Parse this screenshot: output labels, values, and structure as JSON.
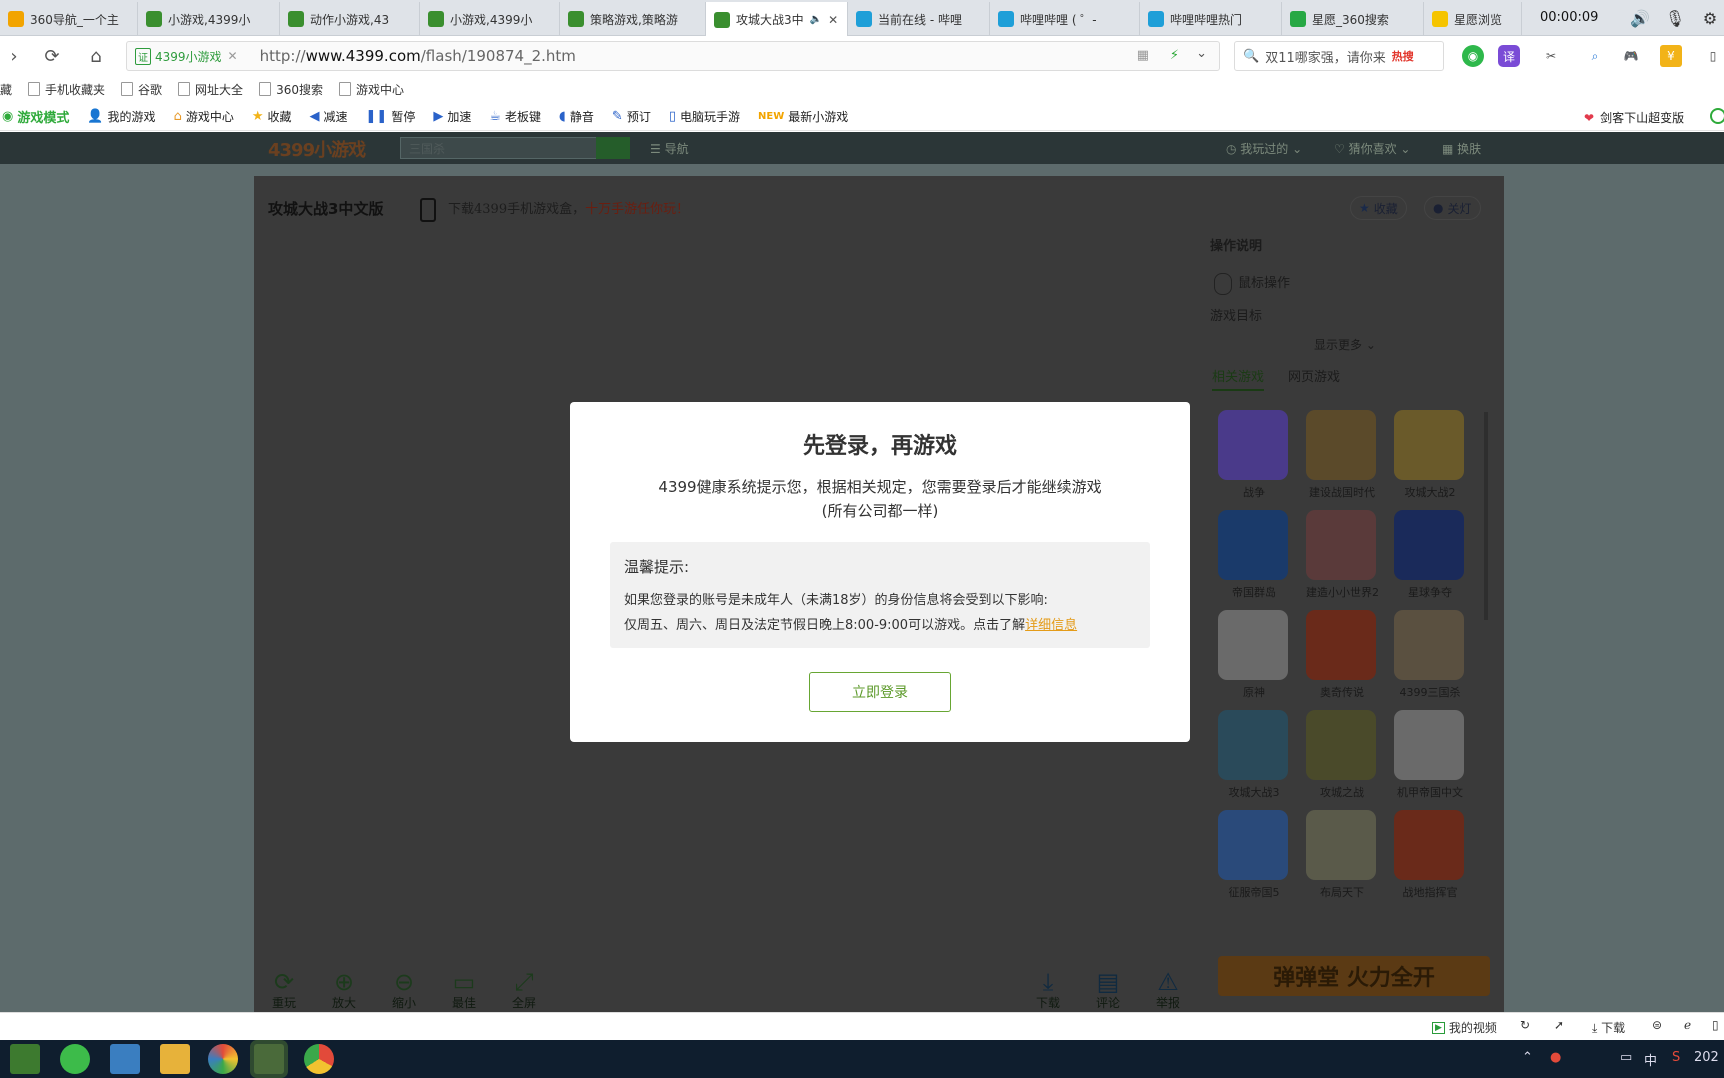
{
  "tabs": [
    {
      "label": "360导航_一个主",
      "color": "#f2a400",
      "active": false
    },
    {
      "label": "小游戏,4399小",
      "color": "#3a8f2f",
      "active": false
    },
    {
      "label": "动作小游戏,43",
      "color": "#3a8f2f",
      "active": false
    },
    {
      "label": "小游戏,4399小",
      "color": "#3a8f2f",
      "active": false
    },
    {
      "label": "策略游戏,策略游",
      "color": "#3a8f2f",
      "active": false
    },
    {
      "label": "攻城大战3中",
      "color": "#3a8f2f",
      "active": true
    },
    {
      "label": "当前在线 - 哔哩",
      "color": "#1e9fd8",
      "active": false
    },
    {
      "label": "哔哩哔哩 ( ゜-",
      "color": "#1e9fd8",
      "active": false
    },
    {
      "label": "哔哩哔哩热门",
      "color": "#1e9fd8",
      "active": false
    },
    {
      "label": "星愿_360搜索",
      "color": "#27a844",
      "active": false
    },
    {
      "label": "星愿浏览",
      "color": "#f5c400",
      "active": false
    }
  ],
  "clock": "00:00:09",
  "url": {
    "badge": "4399小游戏",
    "cert_icon": "证",
    "prefix": "http://",
    "host": "www.4399.com",
    "path": "/flash/190874_2.htm"
  },
  "search": {
    "text": "双11哪家强，请你来",
    "hot": "热搜"
  },
  "bookmarks": [
    "藏",
    "手机收藏夹",
    "谷歌",
    "网址大全",
    "360搜索",
    "游戏中心"
  ],
  "gamebar": {
    "items": [
      {
        "label": "游戏模式",
        "icon": "game-mode-icon"
      },
      {
        "label": "我的游戏",
        "icon": "user-icon"
      },
      {
        "label": "游戏中心",
        "icon": "home-icon"
      },
      {
        "label": "收藏",
        "icon": "star-icon"
      },
      {
        "label": "减速",
        "icon": "slow-icon"
      },
      {
        "label": "暂停",
        "icon": "pause-icon"
      },
      {
        "label": "加速",
        "icon": "fast-icon"
      },
      {
        "label": "老板键",
        "icon": "boss-key-icon"
      },
      {
        "label": "静音",
        "icon": "mute-icon"
      },
      {
        "label": "预订",
        "icon": "reserve-icon"
      },
      {
        "label": "电脑玩手游",
        "icon": "phone-icon"
      },
      {
        "label": "最新小游戏",
        "icon": "new-icon",
        "badge": "NEW"
      }
    ],
    "right_label": "剑客下山超变版"
  },
  "site": {
    "logo": "4399小游戏",
    "search_placeholder": "三国杀",
    "nav_label": "导航",
    "played": "我玩过的",
    "guess": "猜你喜欢",
    "skin": "换肤"
  },
  "game": {
    "title": "攻城大战3中文版",
    "promo_prefix": "下载4399手机游戏盒，",
    "promo_highlight": "十万手游任你玩！",
    "favorite": "收藏",
    "lights": "关灯"
  },
  "sidebar": {
    "ops_title": "操作说明",
    "mouse_op": "鼠标操作",
    "goal": "游戏目标",
    "more": "显示更多",
    "tab_related": "相关游戏",
    "tab_web": "网页游戏",
    "games": [
      {
        "name": "战争",
        "color": "#4a3a8a"
      },
      {
        "name": "建设战国时代",
        "color": "#5b4a2a"
      },
      {
        "name": "攻城大战2",
        "color": "#6a5a2a"
      },
      {
        "name": "帝国群岛",
        "color": "#1a3a6a"
      },
      {
        "name": "建造小小世界2",
        "color": "#5a3a3a"
      },
      {
        "name": "星球争夺",
        "color": "#1a2a5a"
      },
      {
        "name": "原神",
        "color": "#6a6a6a"
      },
      {
        "name": "奥奇传说",
        "color": "#6a2a1a"
      },
      {
        "name": "4399三国杀",
        "color": "#5a5040"
      },
      {
        "name": "攻城大战3",
        "color": "#2a4a5a"
      },
      {
        "name": "攻城之战",
        "color": "#4a4a2a"
      },
      {
        "name": "机甲帝国中文",
        "color": "#6a6a6a"
      },
      {
        "name": "征服帝国5",
        "color": "#2a4a7a"
      },
      {
        "name": "布局天下",
        "color": "#5a5a4a"
      },
      {
        "name": "战地指挥官",
        "color": "#6a2a1a"
      }
    ]
  },
  "controls_left": [
    "重玩",
    "放大",
    "缩小",
    "最佳",
    "全屏"
  ],
  "controls_right": [
    "下载",
    "评论",
    "举报"
  ],
  "banner_text": "弹弹堂 火力全开",
  "modal": {
    "title": "先登录，再游戏",
    "desc1": "4399健康系统提示您，根据相关规定，您需要登录后才能继续游戏",
    "desc2": "(所有公司都一样)",
    "tip_title": "温馨提示:",
    "tip_line1": "如果您登录的账号是未成年人（未满18岁）的身份信息将会受到以下影响:",
    "tip_line2": "仅周五、周六、周日及法定节假日晚上8:00-9:00可以游戏。点击了解",
    "tip_link": "详细信息",
    "login": "立即登录"
  },
  "statusbar": {
    "my_video": "我的视频",
    "download": "下载"
  },
  "tray": {
    "ime": "中",
    "year": "202"
  }
}
